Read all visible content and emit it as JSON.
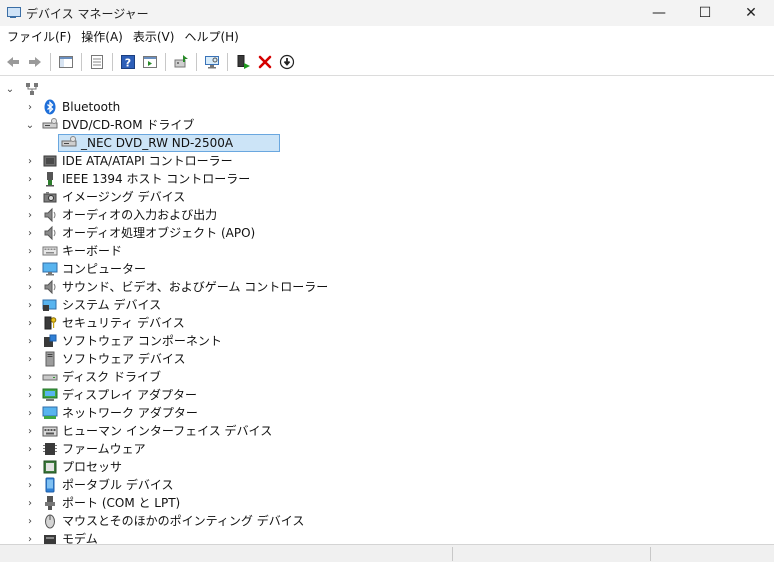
{
  "window": {
    "title": "デバイス マネージャー",
    "minimize": "—",
    "maximize": "☐",
    "close": "✕"
  },
  "menu": [
    "ファイル(F)",
    "操作(A)",
    "表示(V)",
    "ヘルプ(H)"
  ],
  "toolbar": [
    "back-icon",
    "forward-icon",
    "show-hide-console-tree-icon",
    "properties-icon",
    "help-icon",
    "action-pane-icon",
    "update-driver-icon",
    "scan-hardware-icon",
    "enable-device-icon",
    "uninstall-icon",
    "download-icon"
  ],
  "tree": {
    "root_label": "",
    "nodes": [
      {
        "label": "Bluetooth",
        "icon": "bluetooth-icon",
        "expanded": false
      },
      {
        "label": "DVD/CD-ROM ドライブ",
        "icon": "dvd-drive-icon",
        "expanded": true,
        "children": [
          {
            "label": "_NEC DVD_RW ND-2500A",
            "icon": "dvd-drive-icon",
            "selected": true
          }
        ]
      },
      {
        "label": "IDE ATA/ATAPI コントローラー",
        "icon": "ide-controller-icon",
        "expanded": false
      },
      {
        "label": "IEEE 1394 ホスト コントローラー",
        "icon": "ieee1394-icon",
        "expanded": false
      },
      {
        "label": "イメージング デバイス",
        "icon": "camera-icon",
        "expanded": false
      },
      {
        "label": "オーディオの入力および出力",
        "icon": "speaker-icon",
        "expanded": false
      },
      {
        "label": "オーディオ処理オブジェクト (APO)",
        "icon": "speaker-icon",
        "expanded": false
      },
      {
        "label": "キーボード",
        "icon": "keyboard-icon",
        "expanded": false
      },
      {
        "label": "コンピューター",
        "icon": "monitor-icon",
        "expanded": false
      },
      {
        "label": "サウンド、ビデオ、およびゲーム コントローラー",
        "icon": "speaker-icon",
        "expanded": false
      },
      {
        "label": "システム デバイス",
        "icon": "system-device-icon",
        "expanded": false
      },
      {
        "label": "セキュリティ デバイス",
        "icon": "security-key-icon",
        "expanded": false
      },
      {
        "label": "ソフトウェア コンポーネント",
        "icon": "software-component-icon",
        "expanded": false
      },
      {
        "label": "ソフトウェア デバイス",
        "icon": "software-device-icon",
        "expanded": false
      },
      {
        "label": "ディスク ドライブ",
        "icon": "disk-drive-icon",
        "expanded": false
      },
      {
        "label": "ディスプレイ アダプター",
        "icon": "display-adapter-icon",
        "expanded": false
      },
      {
        "label": "ネットワーク アダプター",
        "icon": "network-adapter-icon",
        "expanded": false
      },
      {
        "label": "ヒューマン インターフェイス デバイス",
        "icon": "hid-icon",
        "expanded": false
      },
      {
        "label": "ファームウェア",
        "icon": "firmware-icon",
        "expanded": false
      },
      {
        "label": "プロセッサ",
        "icon": "processor-icon",
        "expanded": false
      },
      {
        "label": "ポータブル デバイス",
        "icon": "portable-device-icon",
        "expanded": false
      },
      {
        "label": "ポート (COM と LPT)",
        "icon": "port-icon",
        "expanded": false
      },
      {
        "label": "マウスとそのほかのポインティング デバイス",
        "icon": "mouse-icon",
        "expanded": false
      },
      {
        "label": "モデム",
        "icon": "modem-icon",
        "expanded": false
      }
    ]
  },
  "colors": {
    "selection_bg": "#cce4f7",
    "selection_border": "#6aa7df",
    "uninstall_red": "#d40000",
    "bluetooth_blue": "#1e6fd9"
  }
}
